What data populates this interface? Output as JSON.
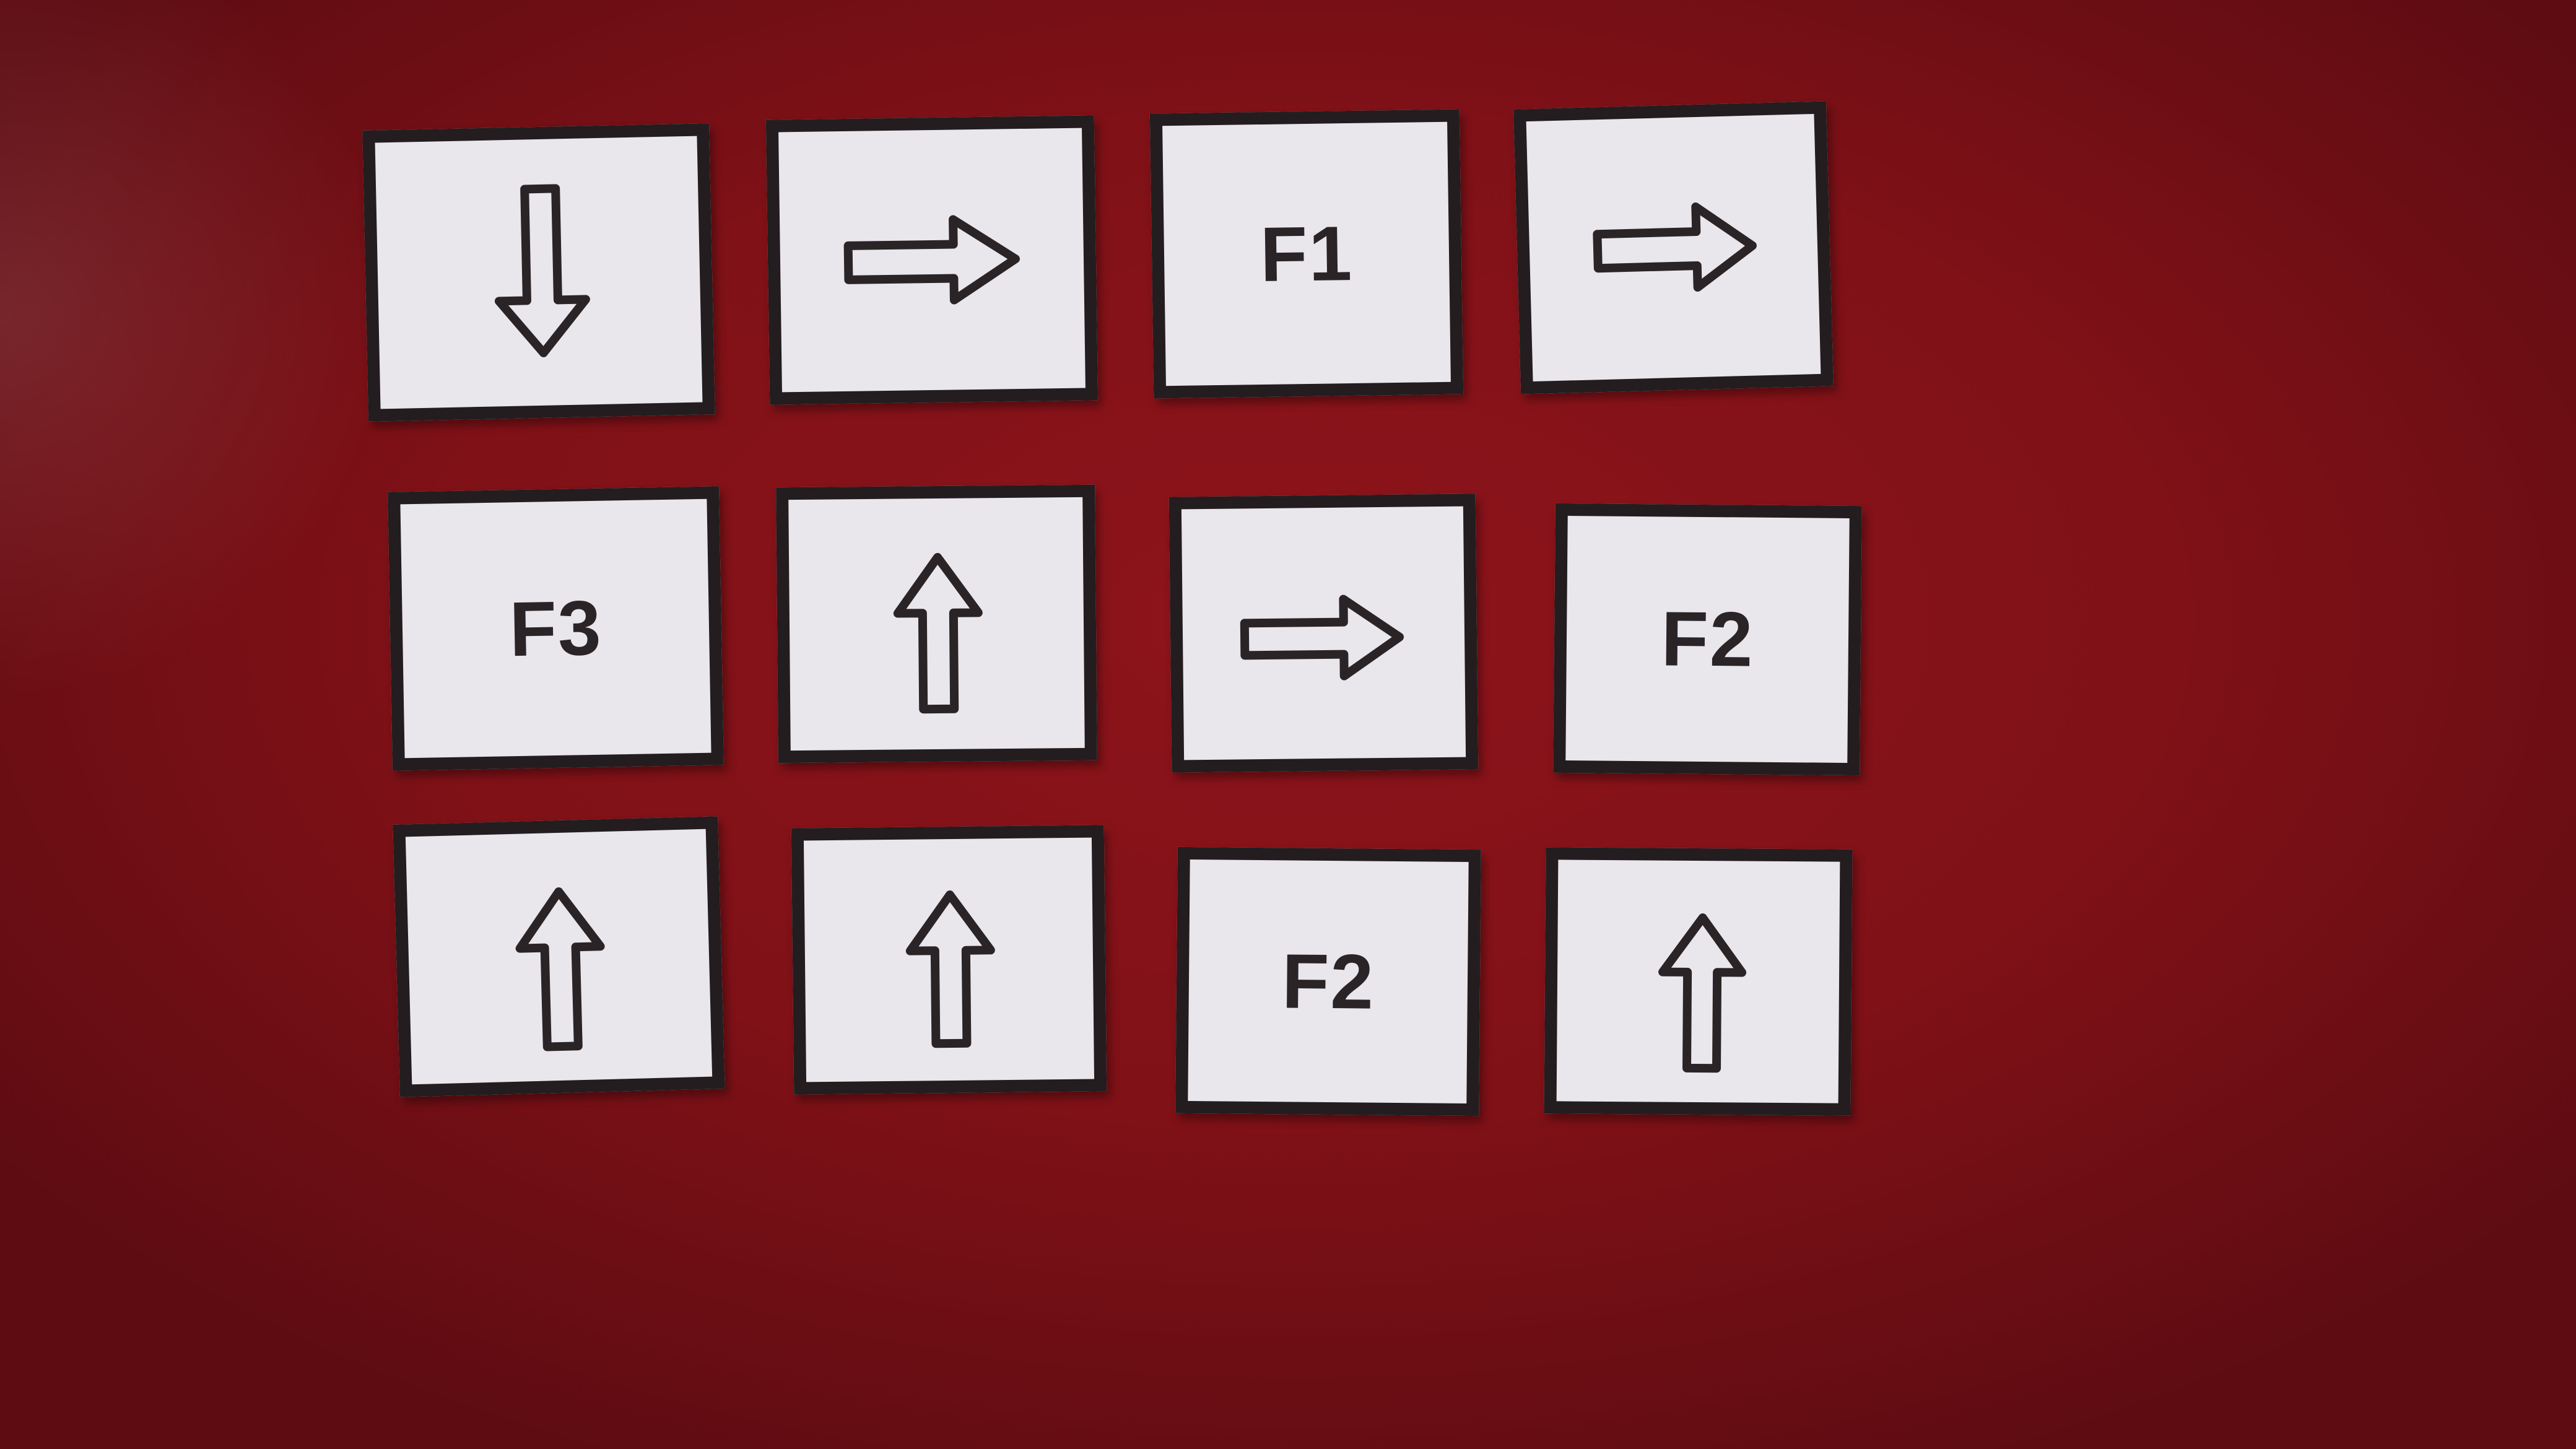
{
  "colors": {
    "background": "#7f1117",
    "card_face": "#e9e6ec",
    "card_border": "#231d1f",
    "ink": "#2a2426"
  },
  "cards": [
    {
      "kind": "arrow",
      "direction": "down",
      "icon": "arrow-down-icon"
    },
    {
      "kind": "arrow",
      "direction": "right",
      "icon": "arrow-right-icon"
    },
    {
      "kind": "text",
      "text": "F1"
    },
    {
      "kind": "arrow",
      "direction": "right",
      "icon": "arrow-right-icon"
    },
    {
      "kind": "text",
      "text": "F3"
    },
    {
      "kind": "arrow",
      "direction": "up",
      "icon": "arrow-up-icon"
    },
    {
      "kind": "arrow",
      "direction": "right",
      "icon": "arrow-right-icon"
    },
    {
      "kind": "text",
      "text": "F2"
    },
    {
      "kind": "arrow",
      "direction": "up",
      "icon": "arrow-up-icon"
    },
    {
      "kind": "arrow",
      "direction": "up",
      "icon": "arrow-up-icon"
    },
    {
      "kind": "text",
      "text": "F2"
    },
    {
      "kind": "arrow",
      "direction": "up",
      "icon": "arrow-up-icon"
    }
  ]
}
